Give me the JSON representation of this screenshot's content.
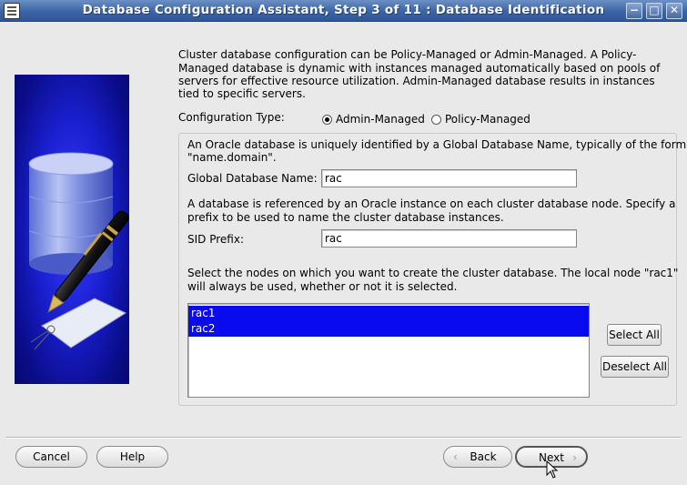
{
  "window": {
    "title": "Database Configuration Assistant, Step 3 of 11 : Database Identification",
    "min_glyph": "−",
    "max_glyph": "□",
    "close_glyph": "✕"
  },
  "intro": {
    "line1": "Cluster database configuration can be Policy-Managed or Admin-Managed. A Policy-",
    "line2": "Managed database is dynamic with instances managed automatically based on pools of",
    "line3": "servers for effective resource utilization. Admin-Managed database results in instances",
    "line4": "tied to specific servers."
  },
  "config_type": {
    "label": "Configuration Type:",
    "options": [
      {
        "label": "Admin-Managed",
        "selected": true
      },
      {
        "label": "Policy-Managed",
        "selected": false
      }
    ]
  },
  "gdn": {
    "desc_line1": "An Oracle database is uniquely identified by a Global Database Name, typically of the form",
    "desc_line2": "\"name.domain\".",
    "label": "Global Database Name:",
    "value": "rac"
  },
  "sid": {
    "desc_line1": "A database is referenced by an Oracle instance on each cluster database node. Specify a",
    "desc_line2": "prefix to be used to name the cluster database instances.",
    "label": "SID Prefix:",
    "value": "rac"
  },
  "nodes": {
    "desc_line1": "Select the nodes on which you want to create the cluster database. The local node \"rac1\"",
    "desc_line2": "will always be used, whether or not it is selected.",
    "items": [
      "rac1",
      "rac2"
    ],
    "select_all": "Select All",
    "deselect_all": "Deselect All"
  },
  "footer": {
    "cancel": "Cancel",
    "help": "Help",
    "back": "Back",
    "next": "Next"
  },
  "icons": {
    "back_arrow": "chevron-left-icon",
    "next_arrow": "chevron-right-icon",
    "illustration": "database-pen-illustration"
  },
  "colors": {
    "titlebar": "#3a64a6",
    "selection": "#0a0aef",
    "illustration_bg": "#1a1fd0"
  }
}
